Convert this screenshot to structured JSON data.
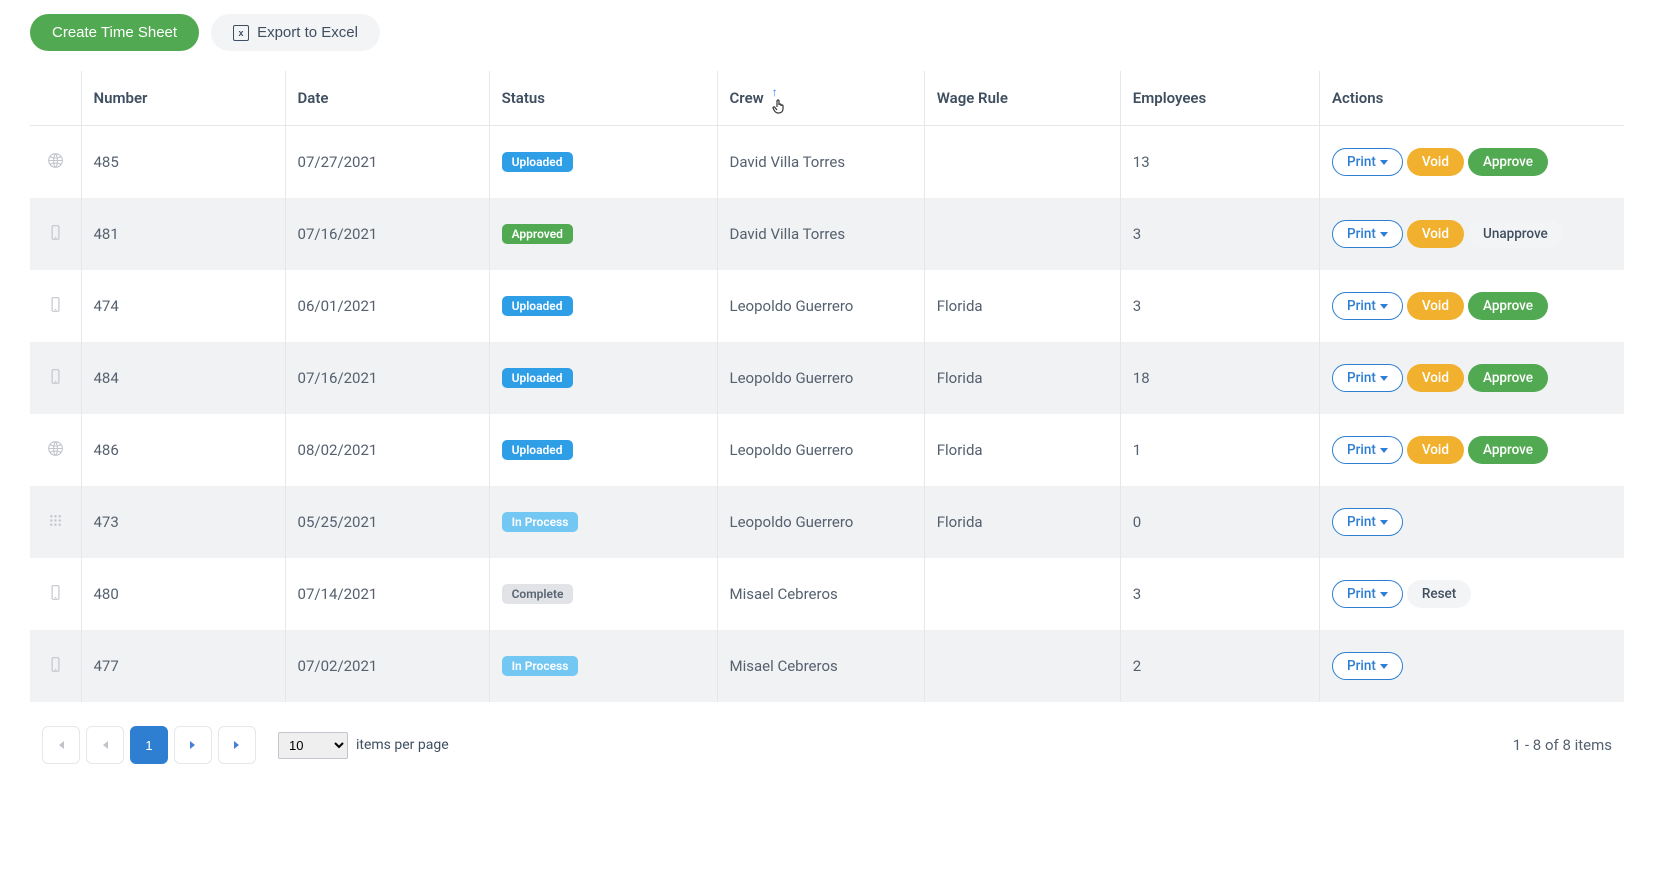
{
  "toolbar": {
    "create_label": "Create Time Sheet",
    "export_label": "Export to Excel"
  },
  "columns": {
    "number": "Number",
    "date": "Date",
    "status": "Status",
    "crew": "Crew",
    "wage_rule": "Wage Rule",
    "employees": "Employees",
    "actions": "Actions"
  },
  "status_labels": {
    "uploaded": "Uploaded",
    "approved": "Approved",
    "in_process": "In Process",
    "complete": "Complete"
  },
  "action_labels": {
    "print": "Print",
    "void": "Void",
    "approve": "Approve",
    "unapprove": "Unapprove",
    "reset": "Reset"
  },
  "rows": [
    {
      "icon": "globe",
      "number": "485",
      "date": "07/27/2021",
      "status": "uploaded",
      "crew": "David Villa Torres",
      "wage_rule": "",
      "employees": "13",
      "actions": [
        "print",
        "void",
        "approve"
      ]
    },
    {
      "icon": "phone",
      "number": "481",
      "date": "07/16/2021",
      "status": "approved",
      "crew": "David Villa Torres",
      "wage_rule": "",
      "employees": "3",
      "actions": [
        "print",
        "void",
        "unapprove"
      ]
    },
    {
      "icon": "phone",
      "number": "474",
      "date": "06/01/2021",
      "status": "uploaded",
      "crew": "Leopoldo Guerrero",
      "wage_rule": "Florida",
      "employees": "3",
      "actions": [
        "print",
        "void",
        "approve"
      ]
    },
    {
      "icon": "phone",
      "number": "484",
      "date": "07/16/2021",
      "status": "uploaded",
      "crew": "Leopoldo Guerrero",
      "wage_rule": "Florida",
      "employees": "18",
      "actions": [
        "print",
        "void",
        "approve"
      ]
    },
    {
      "icon": "globe",
      "number": "486",
      "date": "08/02/2021",
      "status": "uploaded",
      "crew": "Leopoldo Guerrero",
      "wage_rule": "Florida",
      "employees": "1",
      "actions": [
        "print",
        "void",
        "approve"
      ]
    },
    {
      "icon": "keypad",
      "number": "473",
      "date": "05/25/2021",
      "status": "in_process",
      "crew": "Leopoldo Guerrero",
      "wage_rule": "Florida",
      "employees": "0",
      "actions": [
        "print"
      ]
    },
    {
      "icon": "phone",
      "number": "480",
      "date": "07/14/2021",
      "status": "complete",
      "crew": "Misael Cebreros",
      "wage_rule": "",
      "employees": "3",
      "actions": [
        "print",
        "reset"
      ]
    },
    {
      "icon": "phone",
      "number": "477",
      "date": "07/02/2021",
      "status": "in_process",
      "crew": "Misael Cebreros",
      "wage_rule": "",
      "employees": "2",
      "actions": [
        "print"
      ]
    }
  ],
  "pagination": {
    "current_page": "1",
    "page_size": "10",
    "items_per_page_label": "items per page",
    "range_label": "1 - 8 of 8 items"
  }
}
